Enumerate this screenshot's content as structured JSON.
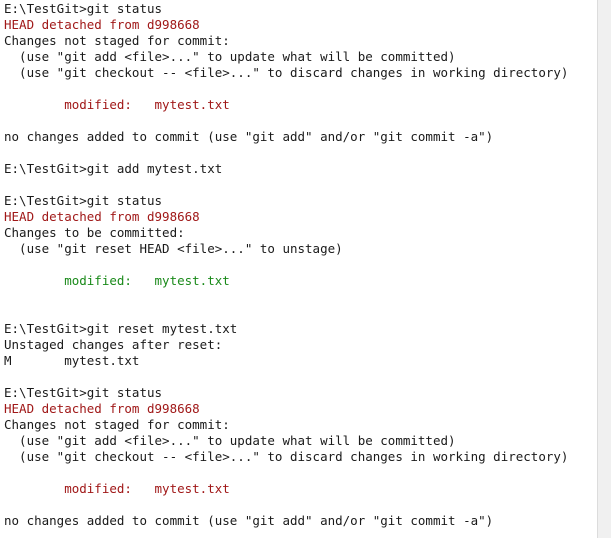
{
  "colors": {
    "background": "#ffffff",
    "text": "#1a1a1a",
    "detached_red": "#a01818",
    "modified_red": "#a01818",
    "staged_green": "#1a8a1a"
  },
  "terminal": {
    "lines": {
      "l01": "E:\\TestGit>git status",
      "l02": "HEAD detached from d998668",
      "l03": "Changes not staged for commit:",
      "l04": "  (use \"git add <file>...\" to update what will be committed)",
      "l05": "  (use \"git checkout -- <file>...\" to discard changes in working directory)",
      "l07": "        modified:   mytest.txt",
      "l09": "no changes added to commit (use \"git add\" and/or \"git commit -a\")",
      "l11": "E:\\TestGit>git add mytest.txt",
      "l13": "E:\\TestGit>git status",
      "l14": "HEAD detached from d998668",
      "l15": "Changes to be committed:",
      "l16": "  (use \"git reset HEAD <file>...\" to unstage)",
      "l18": "        modified:   mytest.txt",
      "l21": "E:\\TestGit>git reset mytest.txt",
      "l22": "Unstaged changes after reset:",
      "l23": "M       mytest.txt",
      "l25": "E:\\TestGit>git status",
      "l26": "HEAD detached from d998668",
      "l27": "Changes not staged for commit:",
      "l28": "  (use \"git add <file>...\" to update what will be committed)",
      "l29": "  (use \"git checkout -- <file>...\" to discard changes in working directory)",
      "l31": "        modified:   mytest.txt",
      "l33": "no changes added to commit (use \"git add\" and/or \"git commit -a\")"
    }
  }
}
